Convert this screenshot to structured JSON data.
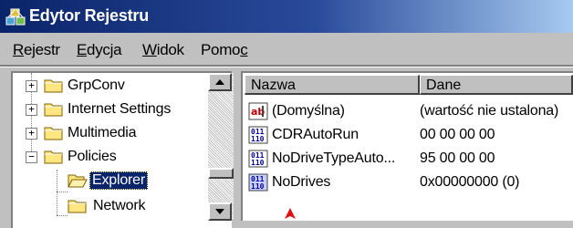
{
  "window": {
    "title": "Edytor Rejestru",
    "icon": "registry-editor-icon"
  },
  "menu": {
    "items": [
      {
        "pre": "",
        "key": "R",
        "post": "ejestr"
      },
      {
        "pre": "",
        "key": "E",
        "post": "dycja"
      },
      {
        "pre": "",
        "key": "W",
        "post": "idok"
      },
      {
        "pre": "Pomo",
        "key": "c",
        "post": ""
      }
    ]
  },
  "tree": {
    "items": [
      {
        "label": "GrpConv",
        "expander": "+",
        "icon": "folder-icon"
      },
      {
        "label": "Internet Settings",
        "expander": "+",
        "icon": "folder-icon"
      },
      {
        "label": "Multimedia",
        "expander": "+",
        "icon": "folder-icon"
      },
      {
        "label": "Policies",
        "expander": "−",
        "icon": "folder-icon"
      },
      {
        "label": "Explorer",
        "expander": "",
        "icon": "open-folder-icon",
        "selected": true
      },
      {
        "label": "Network",
        "expander": "",
        "icon": "folder-icon"
      }
    ]
  },
  "list": {
    "columns": [
      "Nazwa",
      "Dane"
    ],
    "rows": [
      {
        "icon": "string-value-icon",
        "name": "(Domyślna)",
        "data": "(wartość nie ustalona)"
      },
      {
        "icon": "binary-value-icon",
        "name": "CDRAutoRun",
        "data": "00 00 00 00"
      },
      {
        "icon": "binary-value-icon",
        "name": "NoDriveTypeAuto...",
        "data": "95 00 00 00"
      },
      {
        "icon": "dword-value-icon",
        "name": "NoDrives",
        "data": "0x00000000 (0)"
      }
    ]
  },
  "colors": {
    "title_bar": "#0a246a",
    "selection": "#0a246a",
    "annotation_arrow": "#e01010"
  }
}
